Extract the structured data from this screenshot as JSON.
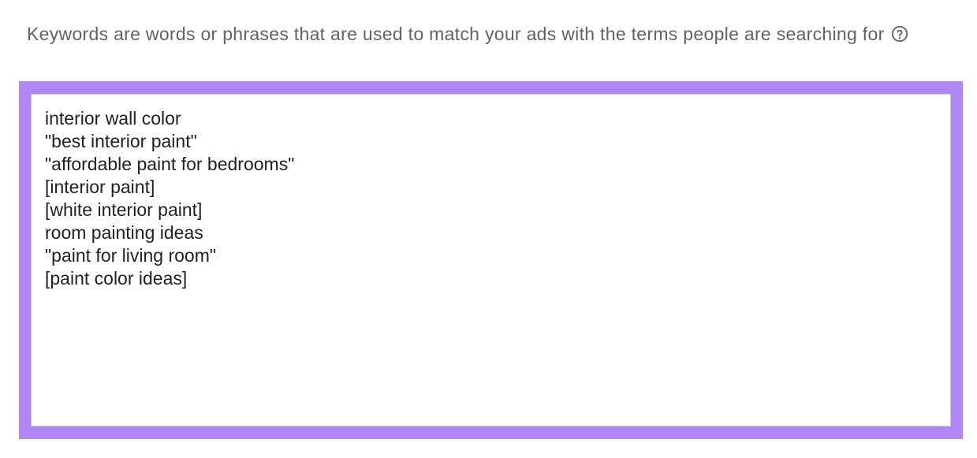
{
  "description": {
    "text": "Keywords are words or phrases that are used to match your ads with the terms people are searching for",
    "help_icon": "help-circle-icon"
  },
  "keywords": {
    "lines": [
      "interior wall color",
      "\"best interior paint\"",
      "\"affordable paint for bedrooms\"",
      "[interior paint]",
      "[white interior paint]",
      "room painting ideas",
      "\"paint for living room\"",
      "[paint color ideas]"
    ]
  },
  "colors": {
    "focus_border": "#b086f5",
    "description_text": "#5f6368",
    "keyword_text": "#202124"
  }
}
